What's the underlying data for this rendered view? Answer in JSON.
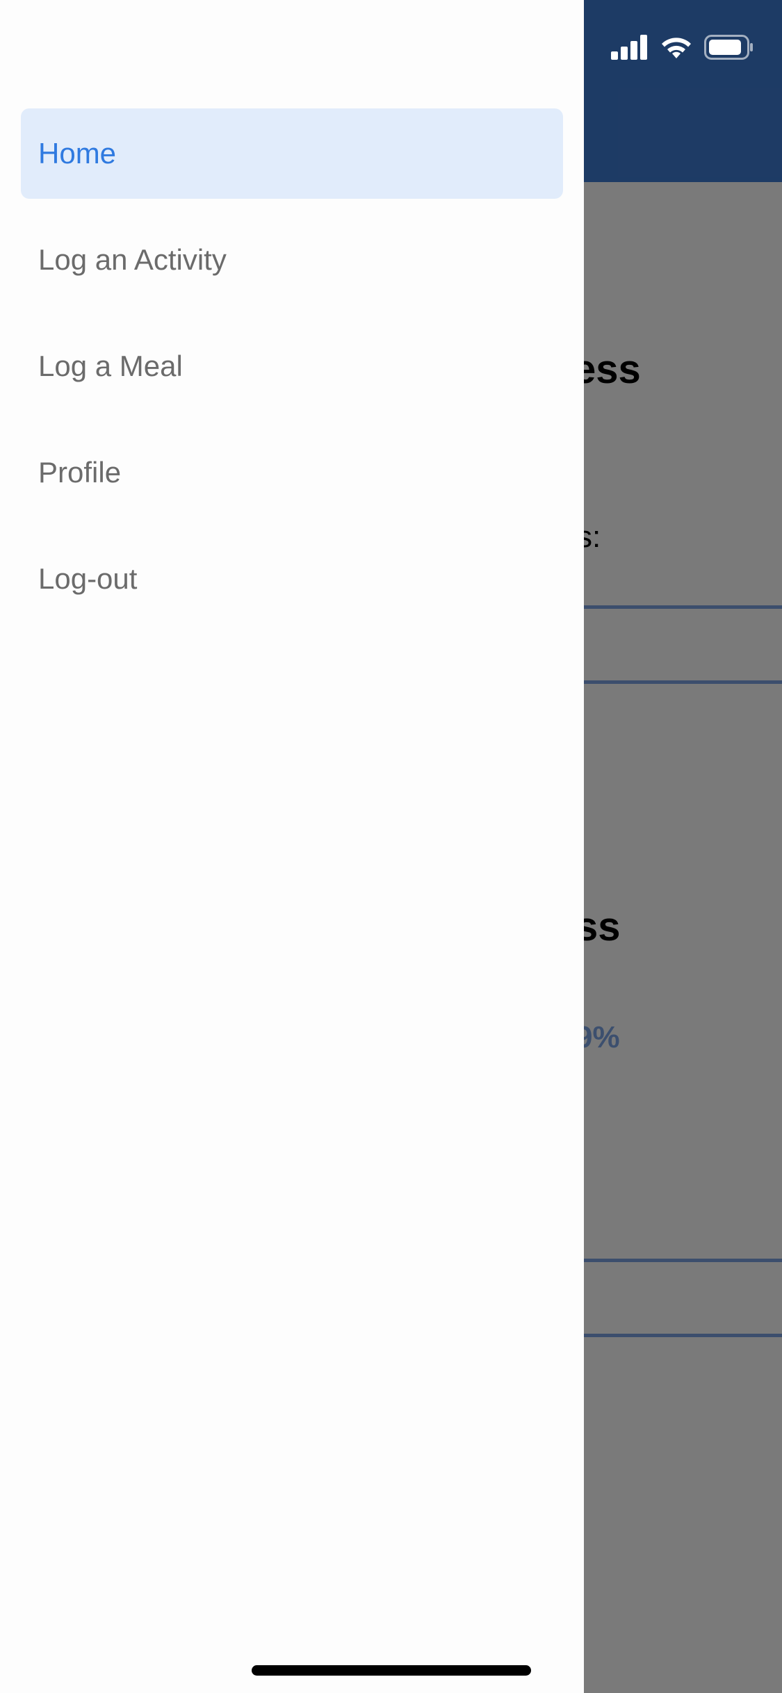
{
  "drawer": {
    "menu": [
      {
        "label": "Home",
        "active": true
      },
      {
        "label": "Log an Activity",
        "active": false
      },
      {
        "label": "Log a Meal",
        "active": false
      },
      {
        "label": "Profile",
        "active": false
      },
      {
        "label": "Log-out",
        "active": false
      }
    ]
  },
  "underlay": {
    "section1_heading_fragment": "ess",
    "section1_label_fragment": "s:",
    "section2_heading_fragment": "ss",
    "section2_percent_fragment": "9%"
  },
  "status_bar": {
    "icons": [
      "cellular-signal-icon",
      "wifi-icon",
      "battery-icon"
    ]
  },
  "colors": {
    "header": "#3e7bd4",
    "active_item_bg": "#e1ecfb",
    "active_item_text": "#2f7ae0",
    "item_text": "#6b6b6b",
    "divider": "#7ea4e3"
  }
}
